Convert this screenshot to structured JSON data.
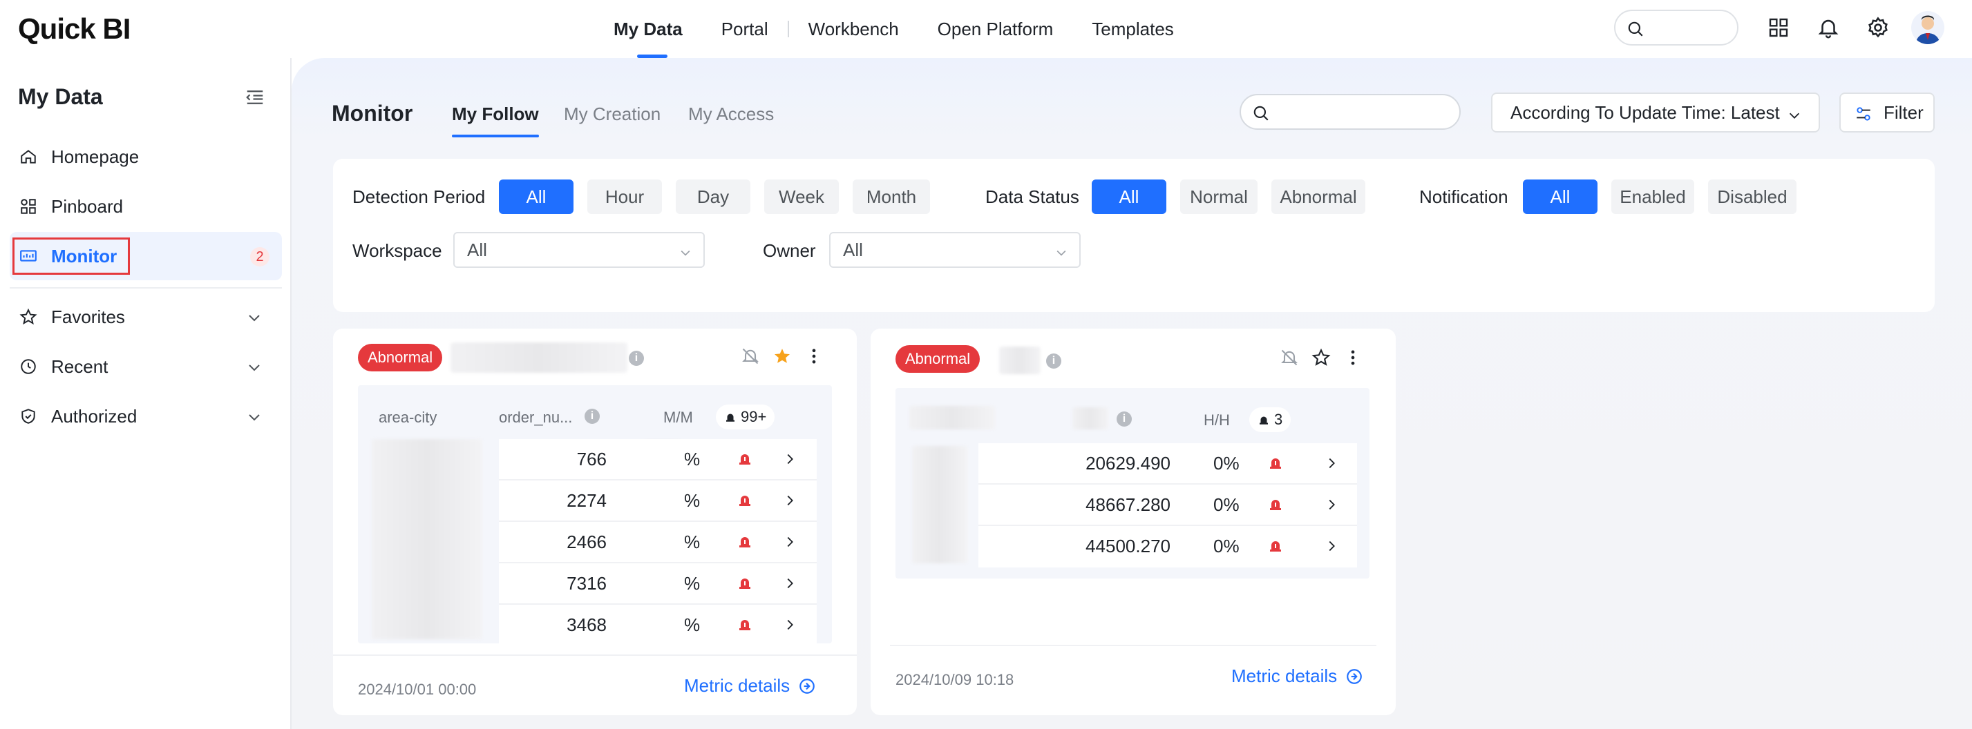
{
  "app": {
    "logo": "Quick BI"
  },
  "topnav": {
    "items": [
      {
        "label": "My Data",
        "active": true
      },
      {
        "label": "Portal",
        "active": false
      },
      {
        "label": "Workbench",
        "active": false
      },
      {
        "label": "Open Platform",
        "active": false
      },
      {
        "label": "Templates",
        "active": false
      }
    ],
    "icons": [
      "search-icon",
      "apps-grid-icon",
      "bell-icon",
      "gear-icon",
      "avatar"
    ]
  },
  "sidebar": {
    "title": "My Data",
    "items": [
      {
        "label": "Homepage",
        "icon": "home-icon"
      },
      {
        "label": "Pinboard",
        "icon": "pinboard-icon"
      },
      {
        "label": "Monitor",
        "icon": "monitor-icon",
        "active": true,
        "badge": "2"
      },
      {
        "label": "Favorites",
        "icon": "star-icon"
      },
      {
        "label": "Recent",
        "icon": "clock-icon"
      },
      {
        "label": "Authorized",
        "icon": "shield-icon"
      }
    ]
  },
  "main": {
    "title": "Monitor",
    "tabs": [
      {
        "label": "My Follow",
        "active": true
      },
      {
        "label": "My Creation",
        "active": false
      },
      {
        "label": "My Access",
        "active": false
      }
    ],
    "search": {
      "placeholder": ""
    },
    "sort": {
      "value": "According To Update Time: Latest"
    },
    "filter_label": "Filter"
  },
  "filters": {
    "detection_period": {
      "label": "Detection Period",
      "options": [
        "All",
        "Hour",
        "Day",
        "Week",
        "Month"
      ],
      "selected": "All"
    },
    "data_status": {
      "label": "Data Status",
      "options": [
        "All",
        "Normal",
        "Abnormal"
      ],
      "selected": "All"
    },
    "notification": {
      "label": "Notification",
      "options": [
        "All",
        "Enabled",
        "Disabled"
      ],
      "selected": "All"
    },
    "workspace": {
      "label": "Workspace",
      "value": "All"
    },
    "owner": {
      "label": "Owner",
      "value": "All"
    }
  },
  "cards": [
    {
      "status": "Abnormal",
      "starred": true,
      "columns": {
        "dimension": "area-city",
        "metric": "order_nu...",
        "compare": "M/M",
        "alert_count": "99+"
      },
      "rows": [
        {
          "value": "766",
          "pct": "%"
        },
        {
          "value": "2274",
          "pct": "%"
        },
        {
          "value": "2466",
          "pct": "%"
        },
        {
          "value": "7316",
          "pct": "%"
        },
        {
          "value": "3468",
          "pct": "%"
        }
      ],
      "date": "2024/10/01 00:00",
      "link": "Metric details"
    },
    {
      "status": "Abnormal",
      "starred": false,
      "columns": {
        "dimension": "",
        "metric": "",
        "compare": "H/H",
        "alert_count": "3"
      },
      "rows": [
        {
          "value": "20629.490",
          "pct": "0%"
        },
        {
          "value": "48667.280",
          "pct": "0%"
        },
        {
          "value": "44500.270",
          "pct": "0%"
        }
      ],
      "date": "2024/10/09 10:18",
      "link": "Metric details"
    }
  ],
  "colors": {
    "accent": "#1f6fff",
    "danger": "#e5393d",
    "sidebar_active_bg": "#eef3fe"
  }
}
